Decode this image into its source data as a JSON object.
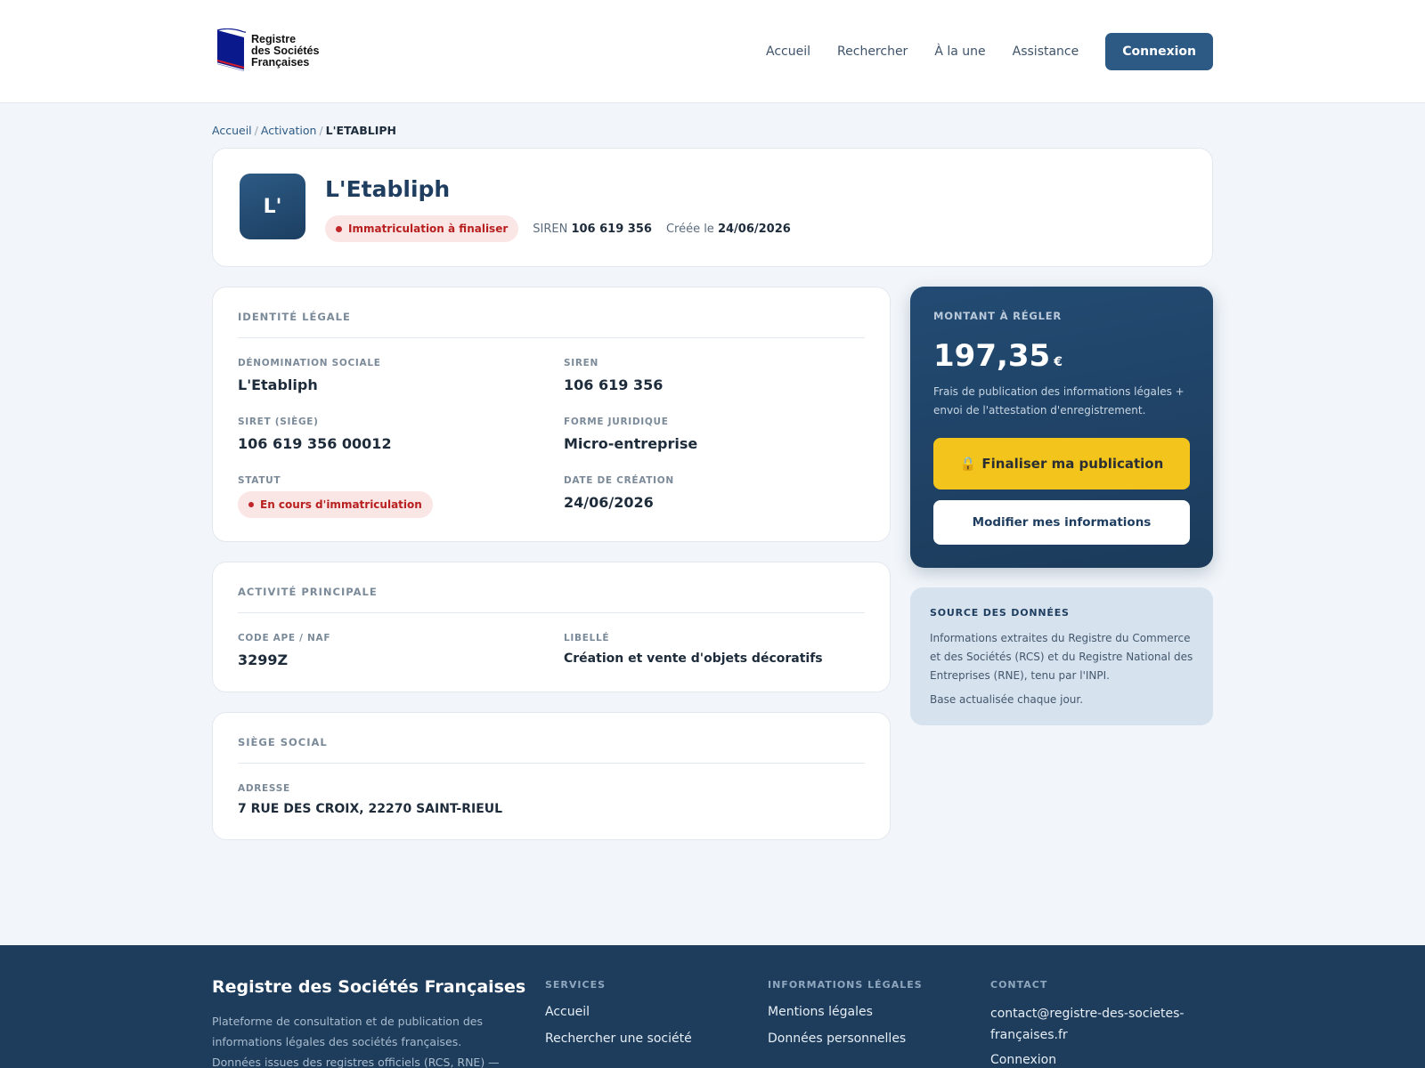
{
  "header": {
    "logo_line1": "Registre",
    "logo_line2": "des Sociétés",
    "logo_line3": "Françaises",
    "nav": [
      "Accueil",
      "Rechercher",
      "À la une",
      "Assistance"
    ],
    "login_label": "Connexion"
  },
  "breadcrumb": {
    "home": "Accueil",
    "parent": "Activation",
    "current": "L'ETABLIPH"
  },
  "company": {
    "initials": "L'",
    "name": "L'Etabliph",
    "status_badge": "Immatriculation à finaliser",
    "siren_label": "SIREN",
    "siren": "106 619 356",
    "created_label": "Créée le",
    "created": "24/06/2026"
  },
  "identity": {
    "title": "IDENTITÉ LÉGALE",
    "denomination_label": "DÉNOMINATION SOCIALE",
    "denomination": "L'Etabliph",
    "siren_label": "SIREN",
    "siren": "106 619 356",
    "siret_label": "SIRET (SIÈGE)",
    "siret": "106 619 356 00012",
    "forme_label": "FORME JURIDIQUE",
    "forme": "Micro-entreprise",
    "statut_label": "STATUT",
    "statut": "En cours d'immatriculation",
    "date_label": "DATE DE CRÉATION",
    "date": "24/06/2026"
  },
  "activity": {
    "title": "ACTIVITÉ PRINCIPALE",
    "code_label": "CODE APE / NAF",
    "code": "3299Z",
    "libelle_label": "LIBELLÉ",
    "libelle": "Création et vente d'objets décoratifs"
  },
  "siege": {
    "title": "SIÈGE SOCIAL",
    "address_label": "ADRESSE",
    "address": "7 RUE DES CROIX, 22270 SAINT-RIEUL"
  },
  "payment": {
    "title": "MONTANT À RÉGLER",
    "amount": "197,35",
    "currency": "€",
    "description": "Frais de publication des informations légales + envoi de l'attestation d'enregistrement.",
    "finalize_icon": "lock-icon",
    "finalize_label": "Finaliser ma publication",
    "edit_label": "Modifier mes informations"
  },
  "source": {
    "title": "SOURCE DES DONNÉES",
    "text": "Informations extraites du Registre du Commerce et des Sociétés (RCS) et du Registre National des Entreprises (RNE), tenu par l'INPI.",
    "update": "Base actualisée chaque jour."
  },
  "footer": {
    "brand_title": "Registre des Sociétés Françaises",
    "brand_text": "Plateforme de consultation et de publication des informations légales des sociétés françaises. Données issues des registres officiels (RCS, RNE) — INPI.",
    "services_title": "SERVICES",
    "services": [
      "Accueil",
      "Rechercher une société"
    ],
    "legal_title": "INFORMATIONS LÉGALES",
    "legal": [
      "Mentions légales",
      "Données personnelles"
    ],
    "contact_title": "CONTACT",
    "contact_email": "contact@registre-des-societes-françaises.fr",
    "contact_login": "Connexion"
  },
  "colors": {
    "primary": "#2d5a84",
    "navy": "#1e3c5b",
    "accent_yellow": "#f3c51c",
    "alert_red": "#b81f1f"
  }
}
